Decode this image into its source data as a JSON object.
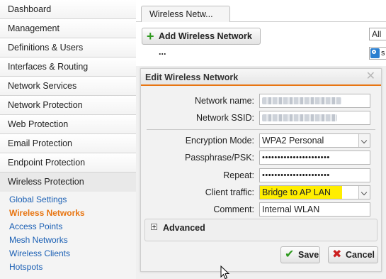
{
  "sidebar": {
    "items": [
      {
        "label": "Dashboard"
      },
      {
        "label": "Management"
      },
      {
        "label": "Definitions & Users"
      },
      {
        "label": "Interfaces & Routing"
      },
      {
        "label": "Network Services"
      },
      {
        "label": "Network Protection"
      },
      {
        "label": "Web Protection"
      },
      {
        "label": "Email Protection"
      },
      {
        "label": "Endpoint Protection"
      },
      {
        "label": "Wireless Protection"
      }
    ],
    "subitems": [
      {
        "label": "Global Settings"
      },
      {
        "label": "Wireless Networks"
      },
      {
        "label": "Access Points"
      },
      {
        "label": "Mesh Networks"
      },
      {
        "label": "Wireless Clients"
      },
      {
        "label": "Hotspots"
      }
    ]
  },
  "tabs": {
    "active": "Wireless Netw..."
  },
  "toolbar": {
    "add_label": "Add Wireless Network ...",
    "filter_value": "All",
    "search_text": "s"
  },
  "dialog": {
    "title": "Edit Wireless Network",
    "close_glyph": "✕",
    "fields": {
      "network_name_label": "Network name:",
      "network_ssid_label": "Network SSID:",
      "encryption_label": "Encryption Mode:",
      "encryption_value": "WPA2 Personal",
      "passphrase_label": "Passphrase/PSK:",
      "passphrase_value": "••••••••••••••••••••••",
      "repeat_label": "Repeat:",
      "repeat_value": "••••••••••••••••••••••",
      "client_traffic_label": "Client traffic:",
      "client_traffic_value": "Bridge to AP LAN",
      "comment_label": "Comment:",
      "comment_value": "Internal WLAN"
    },
    "advanced_label": "Advanced",
    "save_label": "Save",
    "cancel_label": "Cancel"
  },
  "colors": {
    "accent": "#e87511",
    "link": "#1a5fb4",
    "highlight": "#ffee00",
    "save_icon": "#2f9a1f",
    "cancel_icon": "#cc1f1f"
  },
  "icons": {
    "add": "plus-icon",
    "save": "check-icon",
    "cancel": "x-icon",
    "close": "close-icon",
    "advanced_toggle": "expand-plus-icon",
    "search": "search-icon",
    "cursor": "mouse-cursor-icon"
  }
}
